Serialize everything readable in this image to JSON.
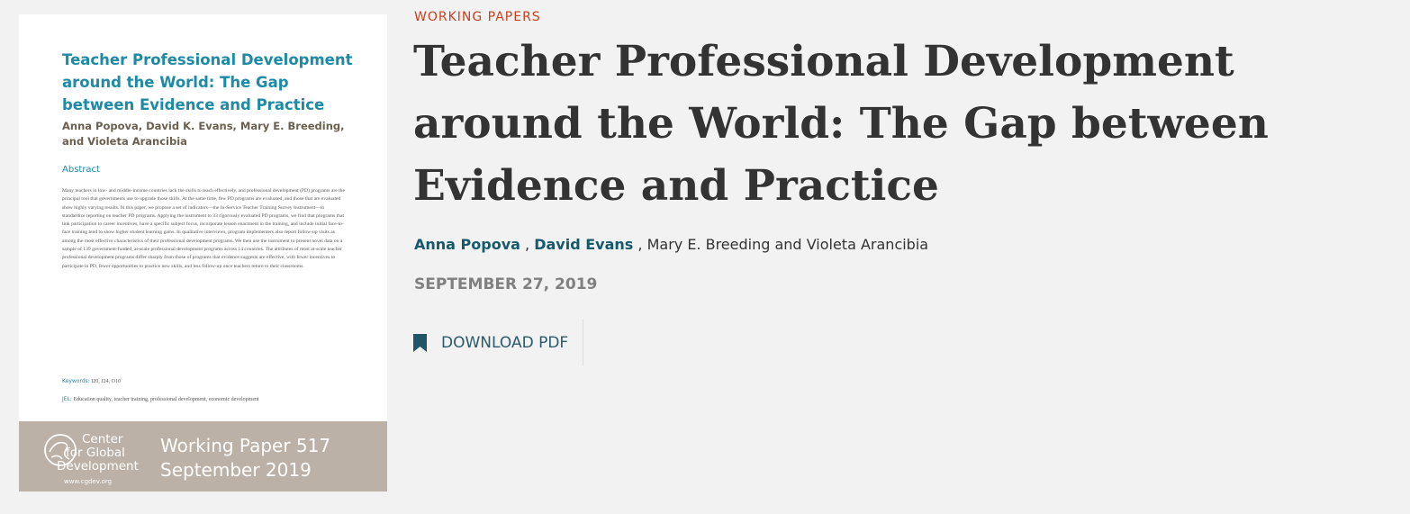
{
  "cover": {
    "title": "Teacher Professional Development around the World: The Gap between Evidence and Practice",
    "authors": "Anna Popova, David K. Evans, Mary E. Breeding, and Violeta Arancibia",
    "abstract_heading": "Abstract",
    "abstract": "Many teachers in low- and middle-income countries lack the skills to teach effectively, and professional development (PD) programs are the principal tool that governments use to upgrade those skills. At the same time, few PD programs are evaluated, and those that are evaluated show highly varying results. In this paper, we propose a set of indicators—the In-Service Teacher Training Survey Instrument—to standardize reporting on teacher PD programs. Applying the instrument to 33 rigorously evaluated PD programs, we find that programs that link participation to career incentives, have a specific subject focus, incorporate lesson enactment in the training, and include initial face-to-face training tend to show higher student learning gains. In qualitative interviews, program implementers also report follow-up visits as among the most effective characteristics of their professional development programs. We then use the instrument to present novel data on a sample of 139 government-funded, at-scale professional development programs across 14 countries. The attributes of most at-scale teacher professional development programs differ sharply from those of programs that evidence suggests are effective, with fewer incentives to participate in PD, fewer opportunities to practice new skills, and less follow-up once teachers return to their classrooms.",
    "keywords_label": "Keywords:",
    "keywords": "I20, J24, O10",
    "jel_label": "JEL:",
    "jel": "Education quality, teacher training, professional development, economic development",
    "org_line1": "Center",
    "org_line2": "for Global",
    "org_line3": "Development",
    "org_url": "www.cgdev.org",
    "wp_number": "Working Paper 517",
    "wp_date": "September 2019"
  },
  "article": {
    "category": "WORKING PAPERS",
    "title": "Teacher Professional Development around the World: The Gap between Evidence and Practice",
    "authors": [
      "Anna Popova",
      "David Evans",
      "Mary E. Breeding",
      "Violeta Arancibia"
    ],
    "author_sep": ",",
    "author_and": "and",
    "date": "SEPTEMBER 27, 2019",
    "download_label": "DOWNLOAD PDF"
  },
  "colors": {
    "background": "#f2f2f2",
    "category": "#c8401f",
    "title": "#333333",
    "author_link": "#16596d",
    "date": "#808080",
    "download": "#2a5b6a",
    "cover_accent": "#1d8aa6",
    "cover_footer": "#bbb1a6"
  },
  "icons": {
    "download": "bookmark-icon",
    "logo": "globe-logo"
  }
}
